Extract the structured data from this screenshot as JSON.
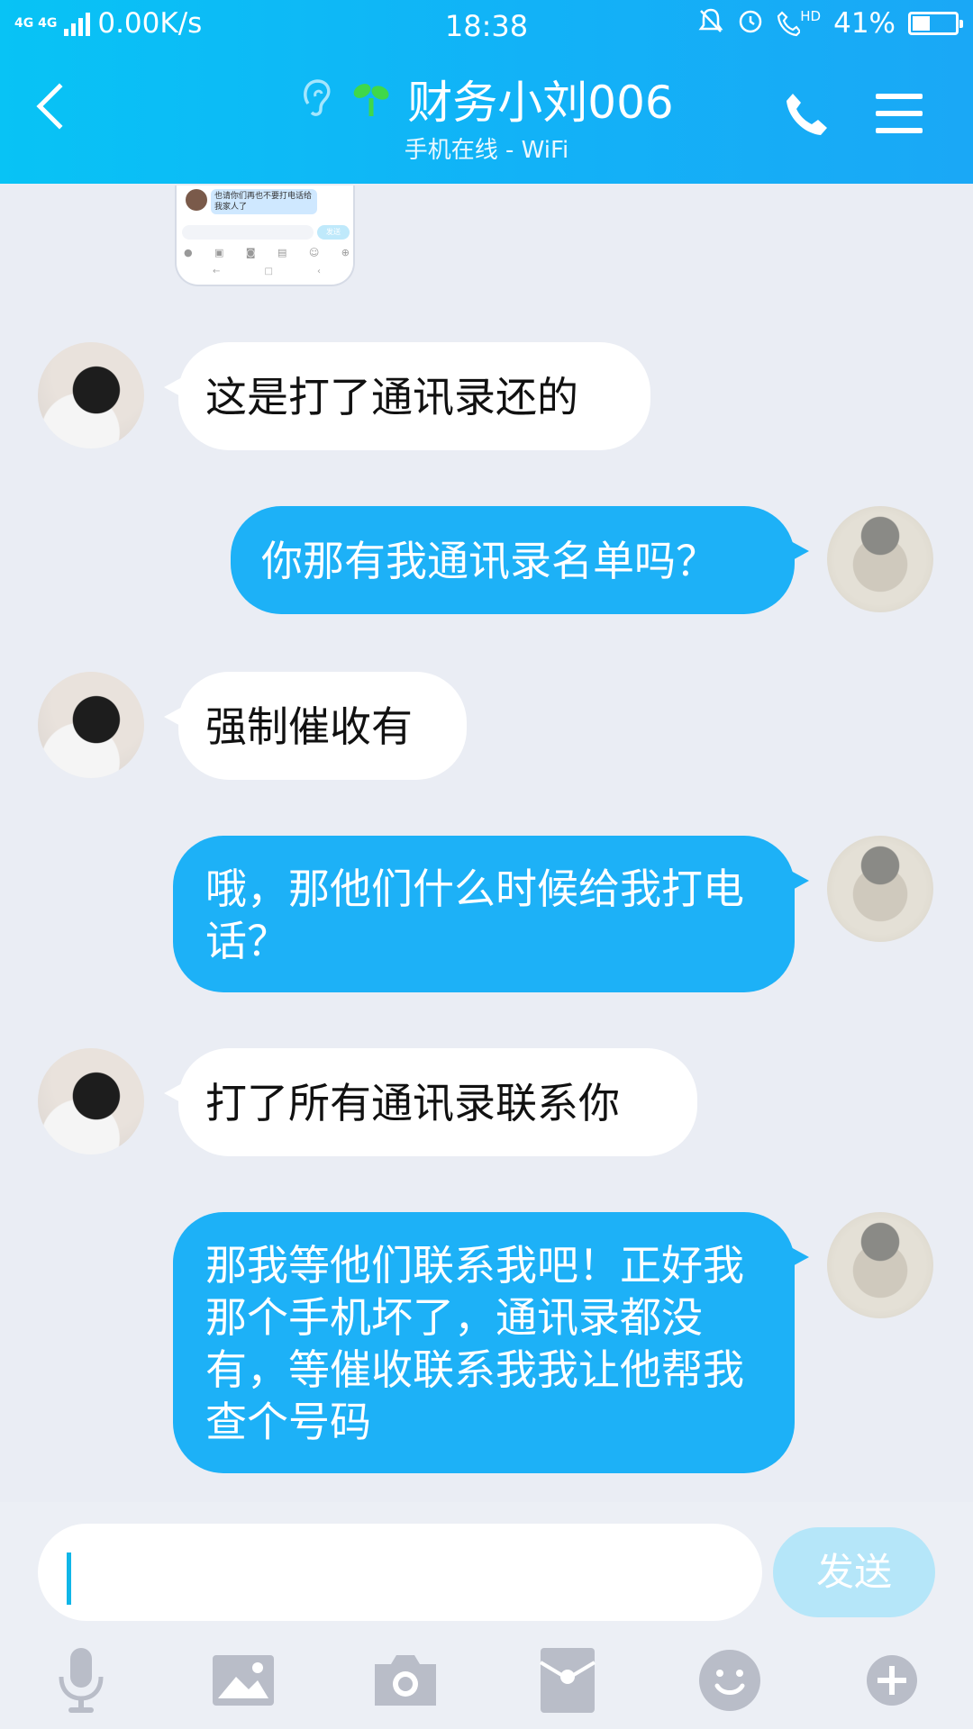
{
  "status_bar": {
    "network": "4G 4G",
    "speed": "0.00K/s",
    "time": "18:38",
    "battery": "41%",
    "battery_level": 0.41,
    "hd_label": "HD",
    "icons": [
      "bell-mute-icon",
      "alarm-icon",
      "hd-call-icon"
    ]
  },
  "header": {
    "title": "财务小刘006",
    "subtitle": "手机在线 - WiFi",
    "back_icon": "chevron-left-icon",
    "phone_icon": "phone-icon",
    "menu_icon": "menu-icon"
  },
  "thumbnail": {
    "text": "也请你们再也不要打电话给我家人了",
    "send": "发送"
  },
  "messages": [
    {
      "side": "left",
      "text": "这是打了通讯录还的"
    },
    {
      "side": "right",
      "text": "你那有我通讯录名单吗？"
    },
    {
      "side": "left",
      "text": "强制催收有"
    },
    {
      "side": "right",
      "text": "哦，那他们什么时候给我打电话？"
    },
    {
      "side": "left",
      "text": "打了所有通讯录联系你"
    },
    {
      "side": "right",
      "text": "那我等他们联系我吧！正好我那个手机坏了，通讯录都没有，等催收联系我我让他帮我查个号码"
    }
  ],
  "input": {
    "value": "",
    "send_label": "发送"
  },
  "toolbar": {
    "icons": [
      "microphone-icon",
      "image-icon",
      "camera-icon",
      "red-packet-icon",
      "emoji-icon",
      "plus-icon"
    ]
  },
  "colors": {
    "header": "#12b2f7",
    "outgoing_bubble": "#1db1f7",
    "incoming_bubble": "#ffffff",
    "background": "#eaedf4",
    "send_button": "#b5e6f9"
  }
}
